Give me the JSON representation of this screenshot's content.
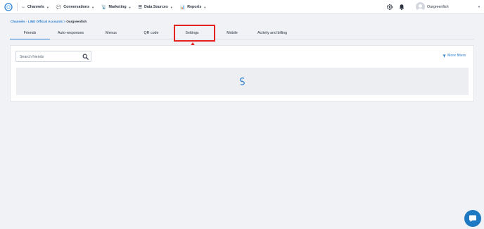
{
  "colors": {
    "accent": "#2c7fd0",
    "highlight_box": "#e42020",
    "annotation_arrow": "#e42020",
    "chat_button": "#1d79c2"
  },
  "header": {
    "logo_icon": "brand-logo-icon",
    "nav": [
      {
        "label": "Channels",
        "icon": "link-arrows-icon",
        "glyph": "↔"
      },
      {
        "label": "Conversations",
        "icon": "chat-bubbles-icon",
        "glyph": "💬"
      },
      {
        "label": "Marketing",
        "icon": "broadcast-icon",
        "glyph": "📡"
      },
      {
        "label": "Data Sources",
        "icon": "list-icon",
        "glyph": "☰"
      },
      {
        "label": "Reports",
        "icon": "bar-chart-icon",
        "glyph": "📊"
      }
    ],
    "settings_icon": "gear-icon",
    "notifications_icon": "bell-icon",
    "username": "Ourgreenfish"
  },
  "breadcrumb": {
    "path": "Channels - LINE Official Accounts > ",
    "current": "Ourgreenfish"
  },
  "tabs": [
    {
      "label": "Friends",
      "active": true
    },
    {
      "label": "Auto-responses",
      "active": false
    },
    {
      "label": "Menus",
      "active": false
    },
    {
      "label": "QR code",
      "active": false
    },
    {
      "label": "Settings",
      "active": false
    },
    {
      "label": "Mobile",
      "active": false
    },
    {
      "label": "Activity and billing",
      "active": false
    }
  ],
  "search": {
    "placeholder": "Search friends",
    "value": ""
  },
  "filters": {
    "more_filters_label": "More filters"
  },
  "results": {
    "loading": true
  }
}
